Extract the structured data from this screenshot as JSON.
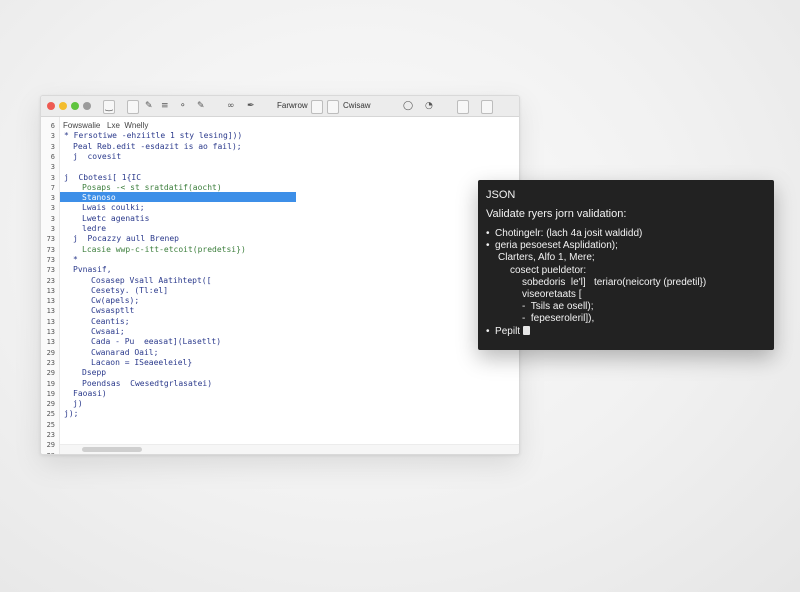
{
  "editor": {
    "toolbar": {
      "icons": [
        "code-icon",
        "file-icon",
        "edit-icon",
        "format-icon",
        "chat-icon",
        "paint-icon",
        "link-icon",
        "pen-icon"
      ],
      "label_left": "Farwrow",
      "label_right": "Cwisaw",
      "right_icons": [
        "refresh-icon",
        "clock-icon",
        "page-icon",
        "expand-icon"
      ]
    },
    "header": "Fowswalie   Lxe  Wnelly",
    "line_numbers": [
      "6",
      "3",
      "3",
      "6",
      "3",
      "3",
      "7",
      "3",
      "3",
      "3",
      "3",
      "73",
      "73",
      "73",
      "73",
      "23",
      "13",
      "13",
      "13",
      "13",
      "13",
      "13",
      "29",
      "23",
      "29",
      "19",
      "19",
      "29",
      "25",
      "25",
      "23",
      "29",
      "29"
    ],
    "highlight_line_index": 6,
    "code_lines": [
      {
        "indent": 0,
        "text": "* Fersotiwe -ehziitle 1 sty lesing]))"
      },
      {
        "indent": 1,
        "text": "Peal Reb.edit -esdazit is ao fail);"
      },
      {
        "indent": 1,
        "text": "j  covesit"
      },
      {
        "indent": 0,
        "text": ""
      },
      {
        "indent": 0,
        "text": "j  Cbotesi[ 1{IC"
      },
      {
        "indent": 2,
        "text": "Posaps -< st sratdatif(aocht)"
      },
      {
        "indent": 2,
        "text": "Stanoso"
      },
      {
        "indent": 2,
        "text": "Lwais coulki;"
      },
      {
        "indent": 2,
        "text": "Lwetc agenatis"
      },
      {
        "indent": 2,
        "text": "ledre"
      },
      {
        "indent": 1,
        "text": "j  Pocazzy aull Brenep"
      },
      {
        "indent": 2,
        "text": "Lcasie wwp-c-itt-etcoit(predetsi})"
      },
      {
        "indent": 1,
        "text": "*"
      },
      {
        "indent": 1,
        "text": "Pvnasif,"
      },
      {
        "indent": 3,
        "text": "Cosasep Vsall Aatihtept(["
      },
      {
        "indent": 3,
        "text": "Cesetsy. (Tl:el]"
      },
      {
        "indent": 3,
        "text": "Cw(apels);"
      },
      {
        "indent": 3,
        "text": "Cwsasptlt"
      },
      {
        "indent": 3,
        "text": "Ceantis;"
      },
      {
        "indent": 3,
        "text": "Cwsaai;"
      },
      {
        "indent": 3,
        "text": "Cada - Pu  eeasat](Lasetlt)"
      },
      {
        "indent": 3,
        "text": "Cwanarad Oail;"
      },
      {
        "indent": 3,
        "text": "Lacaon = ISeaeeleiel}"
      },
      {
        "indent": 2,
        "text": "Dsepp"
      },
      {
        "indent": 2,
        "text": "Poendsas  Cwesedtgrlasatei)"
      },
      {
        "indent": 1,
        "text": "Faoasi)"
      },
      {
        "indent": 1,
        "text": "j)"
      },
      {
        "indent": 0,
        "text": "j);"
      }
    ]
  },
  "panel": {
    "title": "JSON",
    "subtitle": "Validate ryers jorn validation:",
    "lines": [
      {
        "bullet": "•",
        "text": "Chotingelr: (lach 4a josit waldidd)",
        "indent": 0
      },
      {
        "bullet": "•",
        "text": "geria pesoeset Asplidation);",
        "indent": 0
      },
      {
        "bullet": "",
        "text": "Clarters, Alfo 1, Mere;",
        "indent": 1
      },
      {
        "bullet": "",
        "text": "cosect pueldetor:",
        "indent": 2
      },
      {
        "bullet": "",
        "text": "sobedoris  le'l]   teriaro(neicorty (predetil})",
        "indent": 3
      },
      {
        "bullet": "",
        "text": "viseoretaats [",
        "indent": 3
      },
      {
        "bullet": "-",
        "text": "Tsils ae osell);",
        "indent": 3
      },
      {
        "bullet": "-",
        "text": "fepeseroleril]),",
        "indent": 3
      },
      {
        "bullet": "•",
        "text": "Pepilt",
        "indent": 0
      }
    ]
  }
}
